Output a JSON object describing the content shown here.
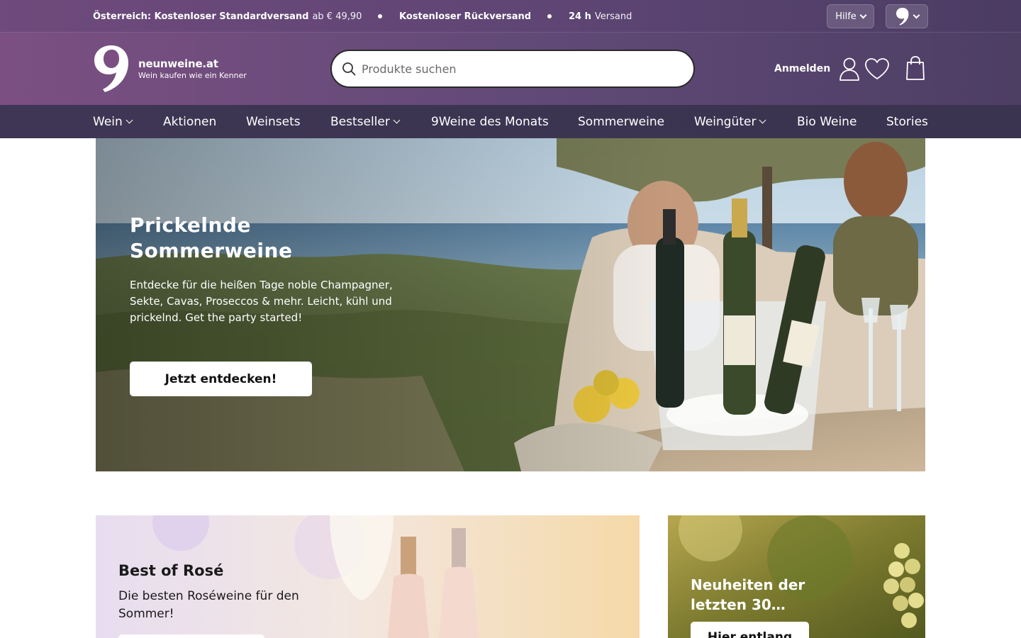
{
  "topbar": {
    "usp1_bold": "Österreich: Kostenloser Standardversand",
    "usp1_light": "ab € 49,90",
    "usp2_bold": "Kostenloser Rückversand",
    "usp3_bold": "24 h",
    "usp3_light": "Versand",
    "help_label": "Hilfe",
    "brand_menu_icon": "nine-logo-icon"
  },
  "header": {
    "logo_name": "neunweine.at",
    "logo_claim": "Wein kaufen wie ein Kenner",
    "search_placeholder": "Produkte suchen",
    "login_label": "Anmelden",
    "icons": [
      "user-icon",
      "heart-icon",
      "shopping-bag-icon"
    ]
  },
  "nav": {
    "items": [
      {
        "label": "Wein",
        "dropdown": true
      },
      {
        "label": "Aktionen",
        "dropdown": false
      },
      {
        "label": "Weinsets",
        "dropdown": false
      },
      {
        "label": "Bestseller",
        "dropdown": true
      },
      {
        "label": "9Weine des Monats",
        "dropdown": false
      },
      {
        "label": "Sommerweine",
        "dropdown": false
      },
      {
        "label": "Weingüter",
        "dropdown": true
      },
      {
        "label": "Bio Weine",
        "dropdown": false
      },
      {
        "label": "Stories",
        "dropdown": false
      }
    ]
  },
  "hero": {
    "title": "Prickelnde Sommerweine",
    "text": "Entdecke für die heißen Tage noble Champagner, Sekte, Cavas, Proseccos & mehr. Leicht, kühl und prickelnd. Get the party started!",
    "cta": "Jetzt entdecken!"
  },
  "teasers": {
    "rose": {
      "title": "Best of Rosé",
      "text": "Die besten Roséweine für den Sommer!"
    },
    "new": {
      "title": "Neuheiten der letzten 30…",
      "cta": "Hier entlang"
    }
  },
  "colors": {
    "header_purple": "#6f4a7c",
    "nav_dark": "#3e3654",
    "white": "#ffffff"
  }
}
